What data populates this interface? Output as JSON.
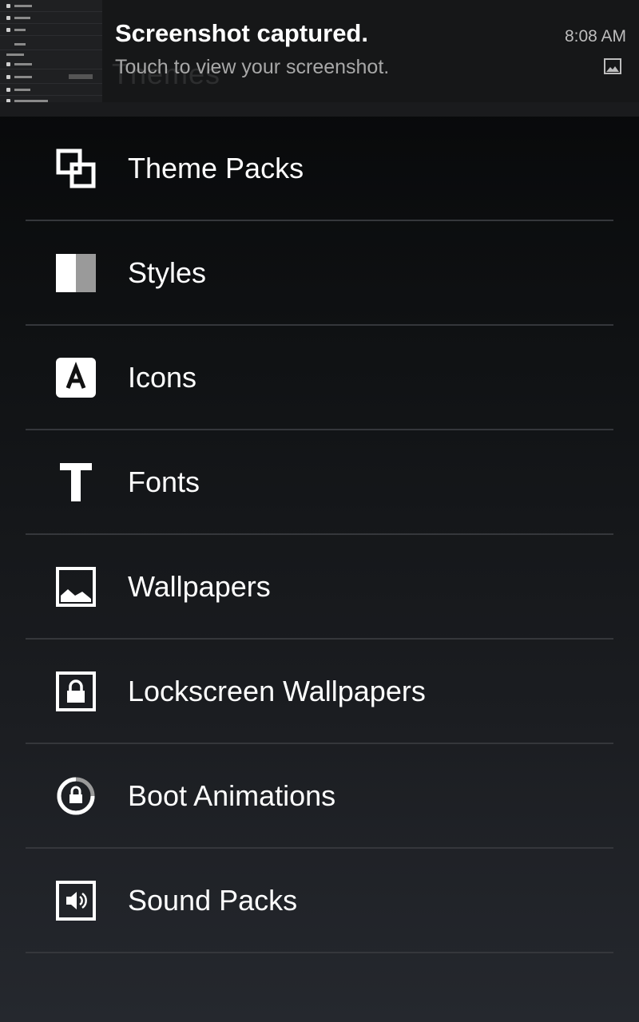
{
  "notification": {
    "title": "Screenshot captured.",
    "text": "Touch to view your screenshot.",
    "time": "8:08 AM",
    "background_title": "Themes"
  },
  "menu": {
    "items": [
      {
        "label": "Theme Packs",
        "icon": "theme-packs-icon"
      },
      {
        "label": "Styles",
        "icon": "styles-icon"
      },
      {
        "label": "Icons",
        "icon": "icons-icon"
      },
      {
        "label": "Fonts",
        "icon": "fonts-icon"
      },
      {
        "label": "Wallpapers",
        "icon": "wallpapers-icon"
      },
      {
        "label": "Lockscreen Wallpapers",
        "icon": "lockscreen-wallpapers-icon"
      },
      {
        "label": "Boot Animations",
        "icon": "boot-animations-icon"
      },
      {
        "label": "Sound Packs",
        "icon": "sound-packs-icon"
      }
    ]
  },
  "colors": {
    "background_top": "#050607",
    "background_bottom": "#25282e",
    "divider": "#35373b",
    "text": "#ffffff",
    "secondary_text": "#a8a8a8"
  }
}
